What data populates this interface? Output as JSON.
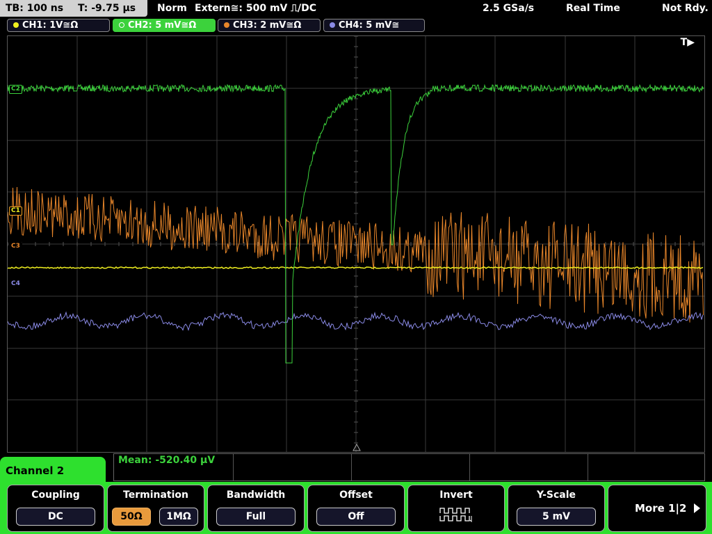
{
  "status_bar": {
    "timebase": "TB: 100 ns",
    "trigger_time": "T: -9.75 µs",
    "trigger_mode": "Norm",
    "trigger_source": "Extern≅: 500 mV ⎍/DC",
    "sample_rate": "2.5 GSa/s",
    "acq_mode": "Real Time",
    "status": "Not Rdy."
  },
  "channels": [
    {
      "label": "CH1: 1V≅Ω",
      "color": "#f0f020",
      "active": false
    },
    {
      "label": "CH2: 5 mV≅Ω",
      "color": "#3cd23c",
      "active": true
    },
    {
      "label": "CH3: 2 mV≅Ω",
      "color": "#e8862a",
      "active": false
    },
    {
      "label": "CH4: 5 mV≅",
      "color": "#8a8ae6",
      "active": false
    }
  ],
  "screen": {
    "trigger_marker": "T▶",
    "ref_labels": {
      "ch2": "C2",
      "ch1": "C1",
      "ch3": "C3",
      "ch4": "C4"
    }
  },
  "measurement": {
    "text": "Mean: -520.40 µV"
  },
  "menu": {
    "title": "Channel 2",
    "softkeys": {
      "coupling": {
        "title": "Coupling",
        "value": "DC"
      },
      "termination": {
        "title": "Termination",
        "options": [
          "50Ω",
          "1MΩ"
        ],
        "selected": "50Ω"
      },
      "bandwidth": {
        "title": "Bandwidth",
        "value": "Full"
      },
      "offset": {
        "title": "Offset",
        "value": "Off"
      },
      "invert": {
        "title": "Invert"
      },
      "yscale": {
        "title": "Y-Scale",
        "value": "5 mV"
      },
      "more": {
        "label": "More 1|2"
      }
    }
  }
}
